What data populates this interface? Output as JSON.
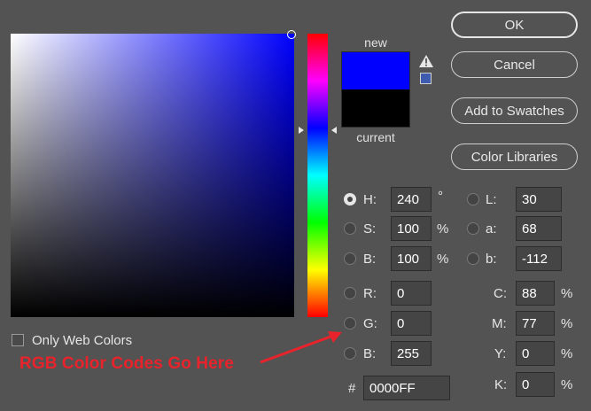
{
  "preview": {
    "new_label": "new",
    "current_label": "current",
    "new_color": "#0000FF",
    "current_color": "#000000"
  },
  "buttons": {
    "ok": "OK",
    "cancel": "Cancel",
    "add_to_swatches": "Add to Swatches",
    "color_libraries": "Color Libraries"
  },
  "hsb": {
    "h": {
      "label": "H:",
      "value": "240",
      "unit": "°"
    },
    "s": {
      "label": "S:",
      "value": "100",
      "unit": "%"
    },
    "b": {
      "label": "B:",
      "value": "100",
      "unit": "%"
    }
  },
  "rgb": {
    "r": {
      "label": "R:",
      "value": "0"
    },
    "g": {
      "label": "G:",
      "value": "0"
    },
    "b": {
      "label": "B:",
      "value": "255"
    }
  },
  "lab": {
    "l": {
      "label": "L:",
      "value": "30"
    },
    "a": {
      "label": "a:",
      "value": "68"
    },
    "b": {
      "label": "b:",
      "value": "-112"
    }
  },
  "cmyk": {
    "c": {
      "label": "C:",
      "value": "88",
      "unit": "%"
    },
    "m": {
      "label": "M:",
      "value": "77",
      "unit": "%"
    },
    "y": {
      "label": "Y:",
      "value": "0",
      "unit": "%"
    },
    "k": {
      "label": "K:",
      "value": "0",
      "unit": "%"
    }
  },
  "hex": {
    "label": "#",
    "value": "0000FF"
  },
  "only_web_colors": {
    "label": "Only Web Colors",
    "checked": false
  },
  "annotation": "RGB Color Codes Go Here",
  "colors": {
    "background": "#535353",
    "annotation_red": "#E8232B"
  },
  "icons": {
    "gamut_warning": "warning-triangle-icon",
    "web_safe": "websafe-swatch-icon"
  }
}
